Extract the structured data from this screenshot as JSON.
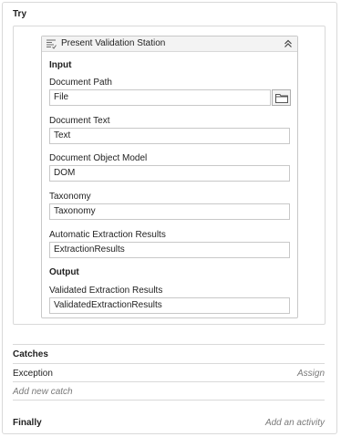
{
  "try": {
    "label": "Try"
  },
  "activity": {
    "title": "Present Validation Station",
    "icon": "validation-station-icon",
    "collapse_icon": "chevron-double-up-icon",
    "input_title": "Input",
    "output_title": "Output",
    "fields": {
      "document_path": {
        "label": "Document Path",
        "value": "File"
      },
      "document_text": {
        "label": "Document Text",
        "value": "Text"
      },
      "document_object_model": {
        "label": "Document Object Model",
        "value": "DOM"
      },
      "taxonomy": {
        "label": "Taxonomy",
        "value": "Taxonomy"
      },
      "automatic_extraction_results": {
        "label": "Automatic Extraction Results",
        "value": "ExtractionResults"
      },
      "validated_extraction_results": {
        "label": "Validated Extraction Results",
        "value": "ValidatedExtractionResults"
      }
    }
  },
  "catches": {
    "label": "Catches",
    "exception_label": "Exception",
    "exception_action": "Assign",
    "add_new_catch": "Add new catch"
  },
  "finally": {
    "label": "Finally",
    "add_activity": "Add an activity"
  }
}
